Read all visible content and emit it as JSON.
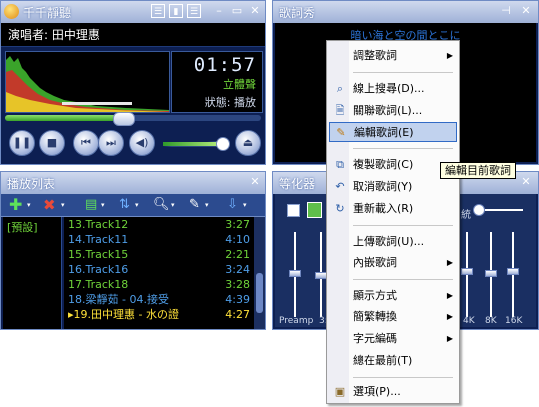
{
  "player": {
    "title": "千千靜聽",
    "artist_line": "演唱者: 田中理惠",
    "time": "01:57",
    "stereo": "立體聲",
    "status": "狀態: 播放",
    "progress_fraction": 0.46,
    "volume_fraction": 0.95
  },
  "lyrics": {
    "title": "歌詞秀",
    "current_line": "暗い海と空の間とこに"
  },
  "playlist": {
    "title": "播放列表",
    "group": "[預設]",
    "tracks": [
      {
        "name": "13.Track12",
        "duration": "3:27",
        "color": "#6fd33a"
      },
      {
        "name": "14.Track11",
        "duration": "4:10",
        "color": "#4f9ee8"
      },
      {
        "name": "15.Track15",
        "duration": "2:21",
        "color": "#6fd33a"
      },
      {
        "name": "16.Track16",
        "duration": "3:24",
        "color": "#4f9ee8"
      },
      {
        "name": "17.Track18",
        "duration": "3:28",
        "color": "#6fd33a"
      },
      {
        "name": "18.梁靜茹 - 04.接受",
        "duration": "4:39",
        "color": "#4f9ee8"
      },
      {
        "name": "▸19.田中理惠 - 水の證",
        "duration": "4:27",
        "color": "#ffe23a"
      }
    ]
  },
  "equalizer": {
    "title": "等化器",
    "bands": [
      "Preamp",
      "3:",
      "4K",
      "8K",
      "16K"
    ]
  },
  "context_menu": {
    "items": [
      {
        "label": "調整歌詞",
        "icon": "",
        "submenu": true
      },
      {
        "label": "線上搜尋(D)...",
        "icon": "search-icon"
      },
      {
        "label": "關聯歌詞(L)...",
        "icon": "link-icon"
      },
      {
        "label": "編輯歌詞(E)",
        "icon": "pencil-icon",
        "highlighted": true
      },
      {
        "label": "複製歌詞(C)",
        "icon": "copy-icon"
      },
      {
        "label": "取消歌詞(Y)",
        "icon": "undo-icon"
      },
      {
        "label": "重新載入(R)",
        "icon": "reload-icon"
      },
      {
        "label": "上傳歌詞(U)...",
        "icon": ""
      },
      {
        "label": "內嵌歌詞",
        "icon": "",
        "submenu": true
      },
      {
        "label": "顯示方式",
        "icon": "",
        "submenu": true
      },
      {
        "label": "簡繁轉換",
        "icon": "",
        "submenu": true
      },
      {
        "label": "字元編碼",
        "icon": "",
        "submenu": true
      },
      {
        "label": "總在最前(T)",
        "icon": ""
      },
      {
        "label": "選項(P)...",
        "icon": "options-icon"
      }
    ],
    "tooltip": "編輯目前歌詞"
  },
  "colors": {
    "panel_bg": "#0d1f52",
    "titlebar": "#9fb1d7",
    "menu_highlight": "#c1d2ee",
    "green_text": "#6fd33a"
  }
}
